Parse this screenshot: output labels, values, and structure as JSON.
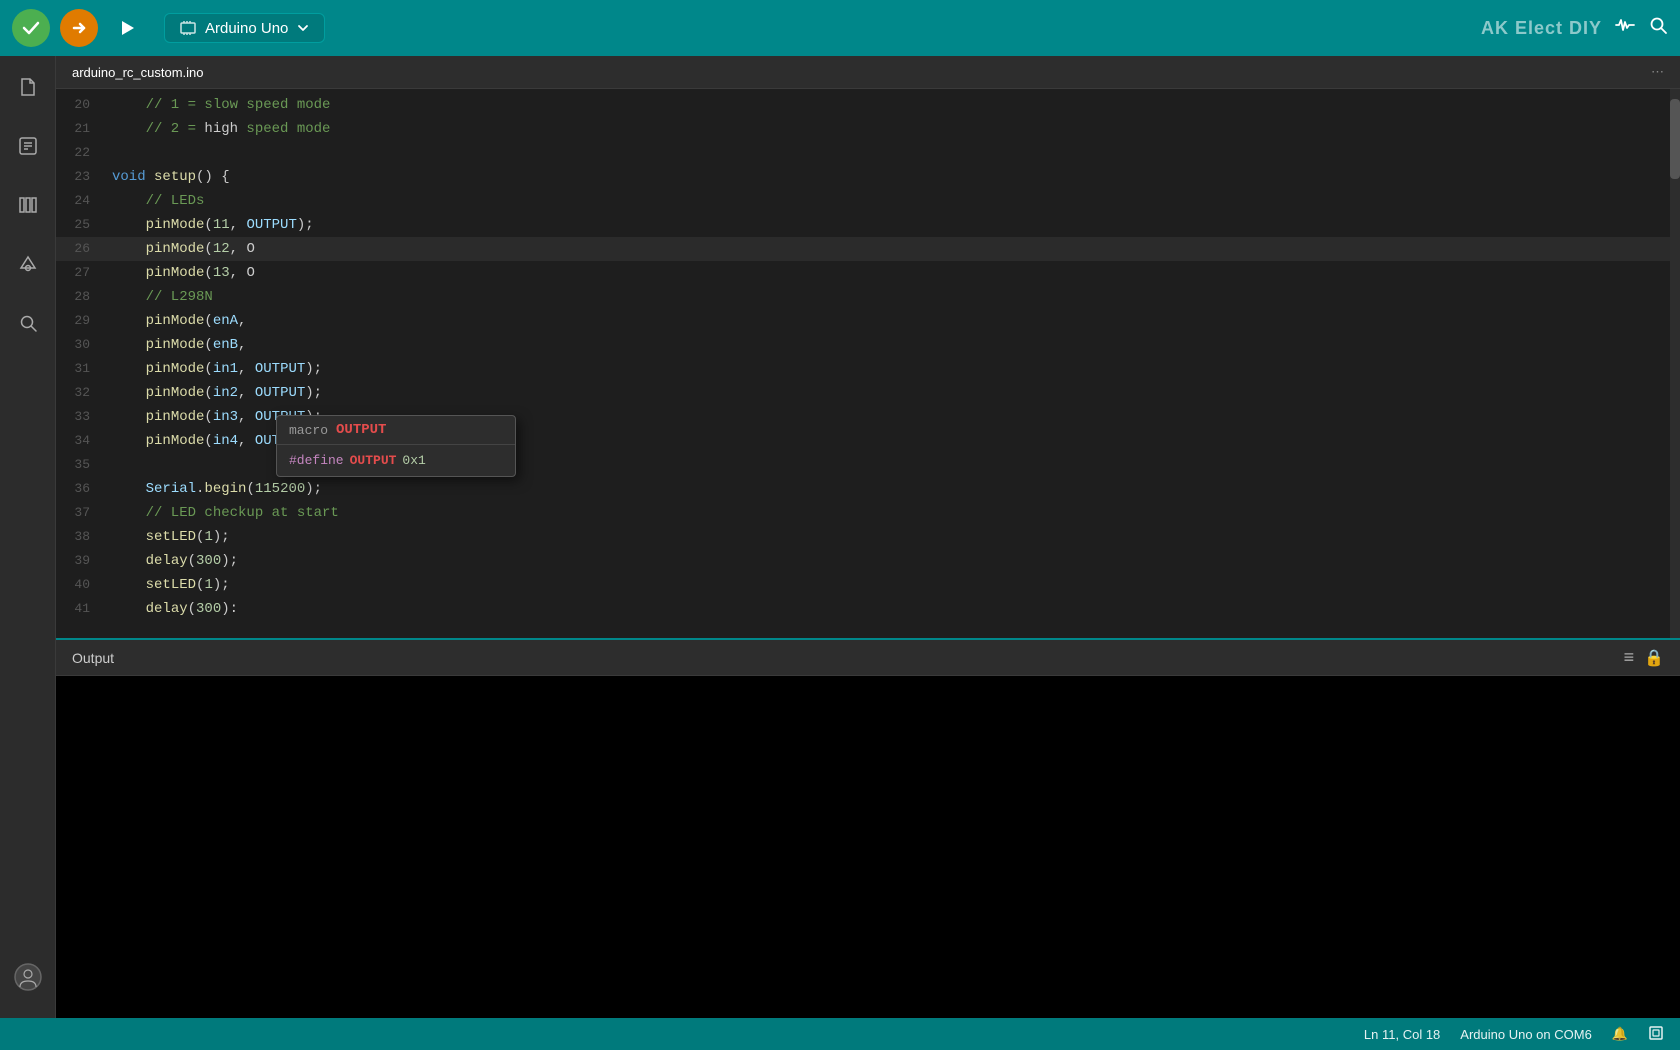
{
  "toolbar": {
    "check_label": "✓",
    "upload_label": "→",
    "debug_label": "▷",
    "board": "Arduino Uno",
    "brand": "AK Elect DIY",
    "more_icon": "⋯",
    "waveform_icon": "〰",
    "search_icon": "🔍"
  },
  "file_tab": {
    "name": "arduino_rc_custom.ino",
    "more": "⋯"
  },
  "sidebar": {
    "icons": [
      "📁",
      "📄",
      "📚",
      "🔌",
      "🔍"
    ]
  },
  "code": {
    "lines": [
      {
        "num": "20",
        "content": "    // 1 = slow speed mode",
        "type": "comment"
      },
      {
        "num": "21",
        "content": "    // 2 = high speed mode",
        "type": "comment"
      },
      {
        "num": "22",
        "content": "",
        "type": "normal"
      },
      {
        "num": "23",
        "content": "void setup() {",
        "type": "normal"
      },
      {
        "num": "24",
        "content": "    // LEDs",
        "type": "comment"
      },
      {
        "num": "25",
        "content": "    pinMode(11, OUTPUT);",
        "type": "normal"
      },
      {
        "num": "26",
        "content": "    pinMode(12, O",
        "type": "autocomplete-line"
      },
      {
        "num": "27",
        "content": "    pinMode(13, O",
        "type": "partial"
      },
      {
        "num": "28",
        "content": "    // L298N",
        "type": "comment"
      },
      {
        "num": "29",
        "content": "    pinMode(enA,",
        "type": "normal"
      },
      {
        "num": "30",
        "content": "    pinMode(enB,",
        "type": "normal"
      },
      {
        "num": "31",
        "content": "    pinMode(in1, OUTPUT);",
        "type": "normal"
      },
      {
        "num": "32",
        "content": "    pinMode(in2, OUTPUT);",
        "type": "normal"
      },
      {
        "num": "33",
        "content": "    pinMode(in3, OUTPUT);",
        "type": "normal"
      },
      {
        "num": "34",
        "content": "    pinMode(in4, OUTPUT);",
        "type": "normal"
      },
      {
        "num": "35",
        "content": "",
        "type": "normal"
      },
      {
        "num": "36",
        "content": "    Serial.begin(115200);",
        "type": "normal"
      },
      {
        "num": "37",
        "content": "    // LED checkup at start",
        "type": "comment"
      },
      {
        "num": "38",
        "content": "    setLED(1);",
        "type": "normal"
      },
      {
        "num": "39",
        "content": "    delay(300);",
        "type": "normal"
      },
      {
        "num": "40",
        "content": "    setLED(1);",
        "type": "normal"
      },
      {
        "num": "41",
        "content": "    delay(300);",
        "type": "normal"
      }
    ]
  },
  "autocomplete": {
    "type_label": "macro",
    "name_label": "OUTPUT",
    "define_keyword": "#define",
    "define_name": "OUTPUT",
    "define_value": "0x1"
  },
  "output": {
    "title": "Output",
    "list_icon": "≡",
    "lock_icon": "🔒"
  },
  "status": {
    "position": "Ln 11, Col 18",
    "board_port": "Arduino Uno on COM6",
    "bell_icon": "🔔",
    "expand_icon": "⊡"
  }
}
